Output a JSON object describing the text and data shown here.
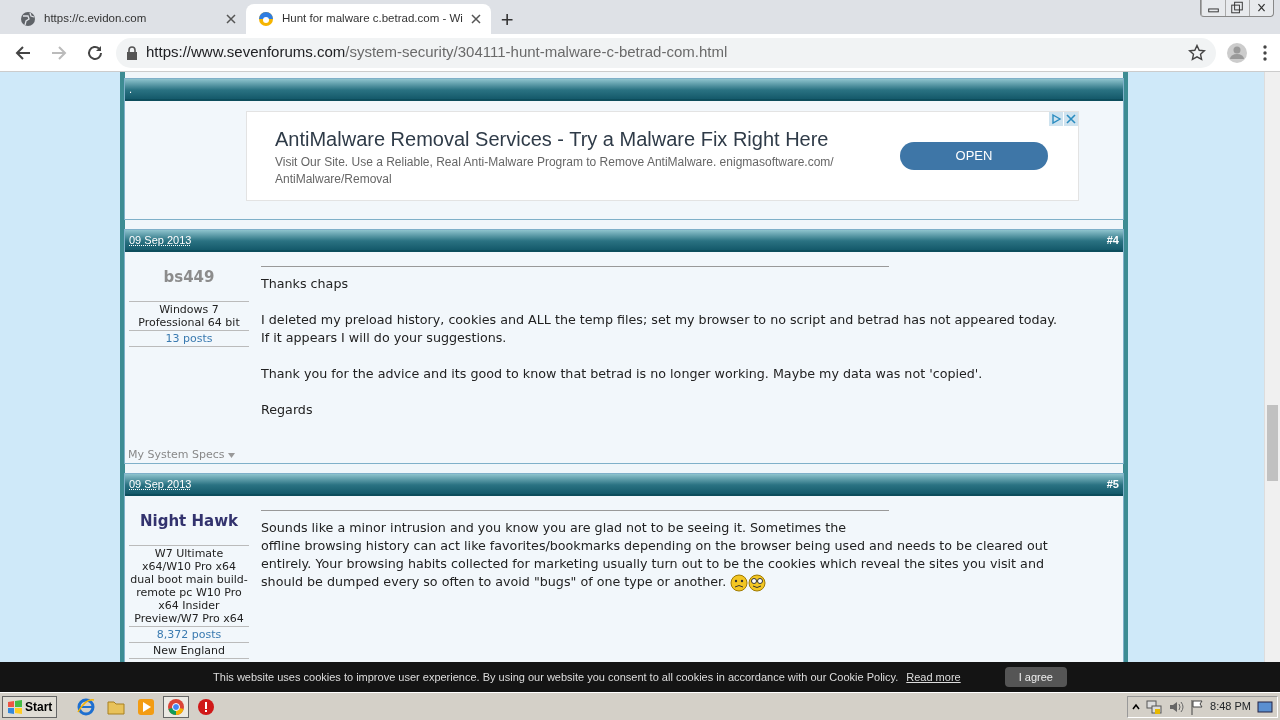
{
  "browser": {
    "tabs": [
      {
        "title": "https://c.evidon.com",
        "kind": "globe",
        "selected": false
      },
      {
        "title": "Hunt for malware c.betrad.com - Wi",
        "kind": "site",
        "selected": true
      }
    ],
    "new_tab": "+",
    "address": {
      "host": "https://www.sevenforums.com",
      "path": "/system-security/304111-hunt-malware-c-betrad-com.html"
    }
  },
  "ad": {
    "header": ".",
    "title": "AntiMalware Removal Services - Try a Malware Fix Right Here",
    "description": "Visit Our Site. Use a Reliable, Real Anti-Malware Program to Remove AntiMalware. enigmasoftware.com/ AntiMalware/Removal",
    "button": "OPEN"
  },
  "posts": [
    {
      "date": "09 Sep 2013",
      "number": "#4",
      "username": "bs449",
      "color": "#8c8c8c",
      "details": [
        "Windows 7 Professional 64 bit"
      ],
      "posts_count": "13 posts",
      "specs": "My System Specs",
      "paragraphs": [
        [
          "Thanks chaps"
        ],
        [
          "I deleted my preload history, cookies and ALL the temp files; set my browser to no script and betrad has not appeared today.",
          "If it appears I will do your suggestions."
        ],
        [
          "Thank you for the advice and its good to know that betrad is no longer working. Maybe my data was not 'copied'."
        ],
        [
          "Regards"
        ]
      ]
    },
    {
      "date": "09 Sep 2013",
      "number": "#5",
      "username": "Night Hawk",
      "color": "#33336e",
      "details": [
        "W7 Ultimate x64/W10 Pro x64 dual boot main build-remote pc W10 Pro x64 Insider Preview/W7 Pro x64"
      ],
      "posts_count": "8,372 posts",
      "location": "New England",
      "paragraphs": [
        [
          "Sounds like a minor intrusion and you know you are glad not to be seeing it. Sometimes the",
          "offline browsing history can act like favorites/bookmarks depending on the browser being used and needs to be cleared out",
          "entirely. Your browsing habits collected for marketing usually turn out to be the cookies which reveal the sites you visit and",
          "should be dumped every so often to avoid \"bugs\" of one type or another."
        ]
      ],
      "emoticons": [
        {
          "kind": "frown"
        },
        {
          "kind": "glasses"
        }
      ]
    }
  ],
  "cookie_bar": {
    "text": "This website uses cookies to improve user experience. By using our website you consent to all cookies in accordance with our Cookie Policy.",
    "link": "Read more",
    "button": "I agree"
  },
  "taskbar": {
    "start": "Start",
    "apps": [
      {
        "kind": "ie",
        "selected": false
      },
      {
        "kind": "folder",
        "selected": false
      },
      {
        "kind": "media",
        "selected": false
      },
      {
        "kind": "chrome",
        "selected": true
      },
      {
        "kind": "opera",
        "selected": false
      }
    ],
    "clock": "8:48 PM"
  }
}
